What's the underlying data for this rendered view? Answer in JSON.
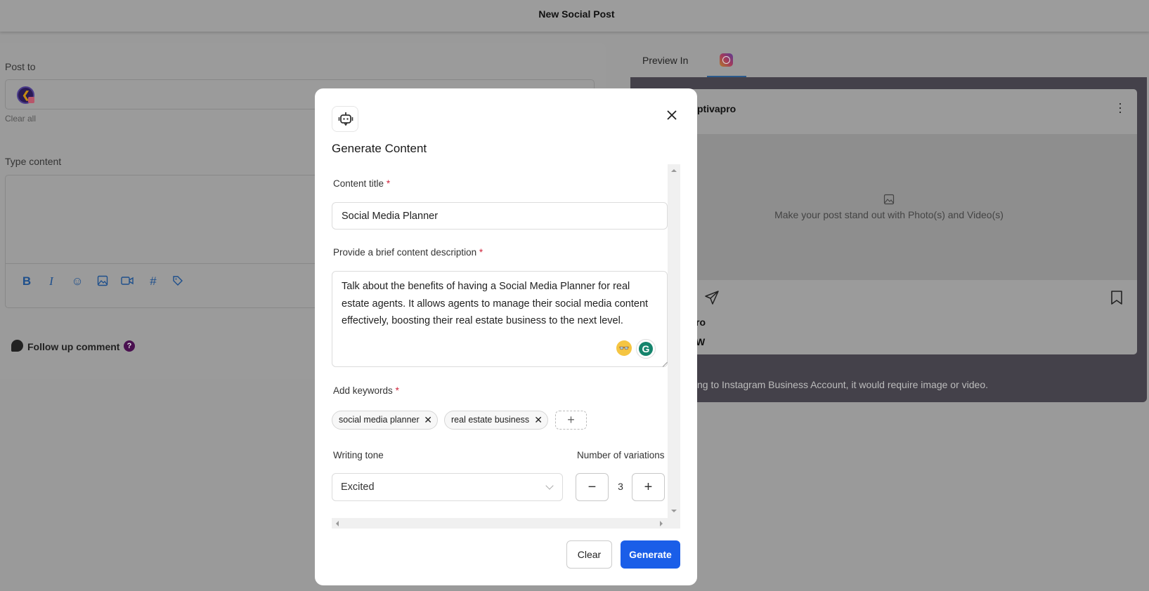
{
  "header": {
    "title": "New Social Post"
  },
  "composer": {
    "post_to_label": "Post to",
    "clear_all": "Clear all",
    "type_content_label": "Type content",
    "toolbar": [
      "bold-icon",
      "italic-icon",
      "emoji-icon",
      "image-icon",
      "video-icon",
      "hashtag-icon",
      "tag-icon"
    ],
    "follow_up_label": "Follow up comment",
    "help_glyph": "?"
  },
  "preview": {
    "tab_label": "Preview In",
    "active_tab": "instagram",
    "username_visible": "ptivapro",
    "media_placeholder": "Make your post stand out with Photo(s) and Video(s)",
    "caption_user_visible": "ro",
    "caption_line_visible": "W",
    "note_visible": "ng to Instagram Business Account, it would require image or video."
  },
  "modal": {
    "title": "Generate Content",
    "content_title_label": "Content title",
    "content_title_value": "Social Media Planner",
    "description_label": "Provide a brief content description",
    "description_value": "Talk about the benefits of having a Social Media Planner for real estate agents. It allows agents to manage their social media content effectively, boosting their real estate business to the next level.",
    "keywords_label": "Add keywords",
    "keywords": [
      "social media planner",
      "real estate business"
    ],
    "writing_tone_label": "Writing tone",
    "writing_tone_value": "Excited",
    "variations_label": "Number of variations",
    "variations_value": "3",
    "required_mark": "*",
    "clear_button": "Clear",
    "generate_button": "Generate"
  },
  "colors": {
    "primary": "#1a5ee8",
    "required": "#d0243c",
    "grammarly": "#15846c"
  }
}
